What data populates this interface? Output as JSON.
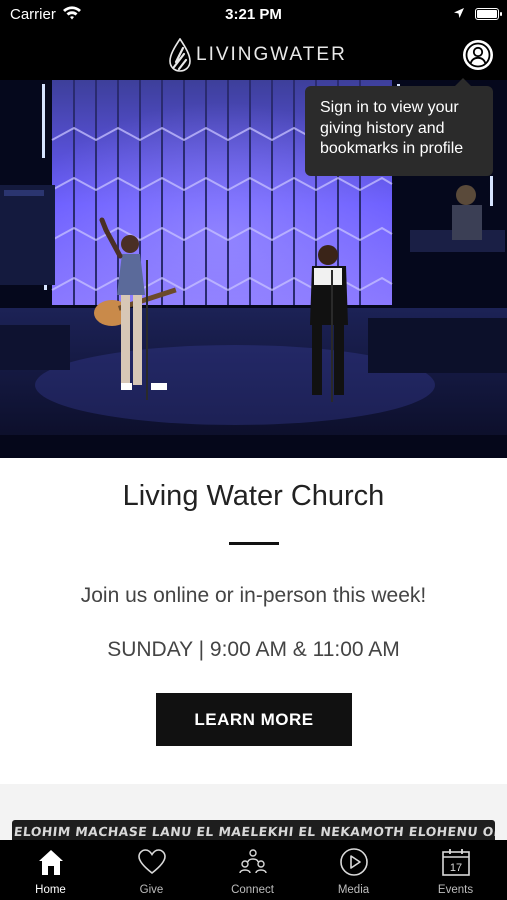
{
  "status_bar": {
    "carrier": "Carrier",
    "time": "3:21 PM"
  },
  "header": {
    "logo_text": "LIVINGWATER",
    "profile_icon": "person-circle-icon"
  },
  "tooltip": {
    "text": "Sign in to view your giving history and bookmarks in profile"
  },
  "hero": {
    "image": "worship-stage-photo"
  },
  "main": {
    "title": "Living Water Church",
    "subtitle": "Join us online or in-person this week!",
    "service_times": "SUNDAY | 9:00 AM & 11:00 AM",
    "cta_label": "LEARN MORE"
  },
  "promo": {
    "text": "ELOHIM MACHASE LANU EL MAELEKHI EL NEKAMOTH ELOHENU OLAM ELOHIM SELAH ELOHE TSADEKI ELOHE YISRAEL"
  },
  "tabs": [
    {
      "label": "Home",
      "icon": "home-icon",
      "active": true
    },
    {
      "label": "Give",
      "icon": "heart-icon",
      "active": false
    },
    {
      "label": "Connect",
      "icon": "people-icon",
      "active": false
    },
    {
      "label": "Media",
      "icon": "play-circle-icon",
      "active": false
    },
    {
      "label": "Events",
      "icon": "calendar-icon",
      "active": false,
      "badge_number": "17"
    }
  ],
  "colors": {
    "bar": "#000000",
    "accent": "#111111",
    "tooltip_bg": "#2b2b2b",
    "stage_light": "#6a5cff"
  }
}
